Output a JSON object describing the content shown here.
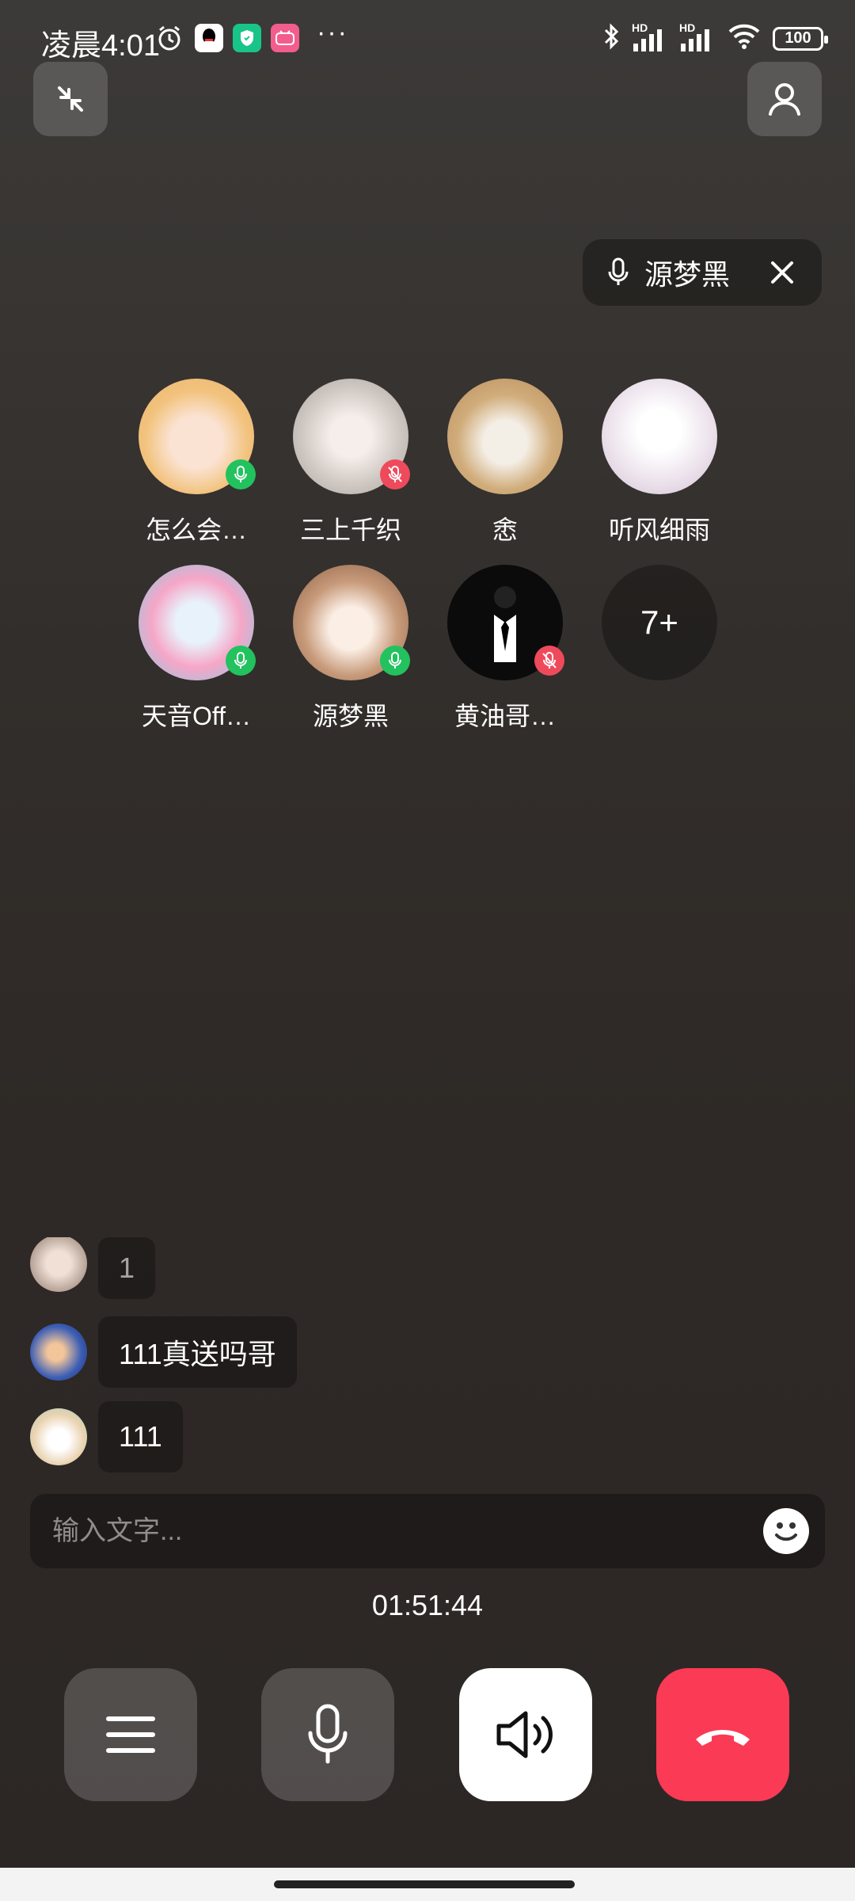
{
  "status": {
    "time": "凌晨4:01",
    "battery": "100",
    "signal_label_1": "HD",
    "signal_label_2": "HD",
    "more": "···"
  },
  "speaking": {
    "name": "源梦黑"
  },
  "members": [
    {
      "name": "怎么会…",
      "mic": "on",
      "color": "#f3c58d"
    },
    {
      "name": "三上千织",
      "mic": "off",
      "color": "#d9d3cf"
    },
    {
      "name": "悆",
      "mic": "none",
      "color": "#d6b58a"
    },
    {
      "name": "听风细雨",
      "mic": "none",
      "color": "#eae3ec"
    },
    {
      "name": "天音Off…",
      "mic": "on",
      "color": "#f6a6c7"
    },
    {
      "name": "源梦黑",
      "mic": "on",
      "color": "#c79a7a"
    },
    {
      "name": "黄油哥…",
      "mic": "off",
      "color": "#111111"
    }
  ],
  "more_members": "7+",
  "chat": [
    {
      "text": "1",
      "avatar_color": "#8a7467"
    },
    {
      "text": "111真送吗哥",
      "avatar_color": "#3d5fb5"
    },
    {
      "text": "111",
      "avatar_color": "#e9d2b0"
    }
  ],
  "input": {
    "placeholder": "输入文字..."
  },
  "timer": "01:51:44",
  "colors": {
    "mic_on": "#22c25f",
    "mic_off": "#ef4a5c",
    "hangup": "#fb3a55"
  }
}
